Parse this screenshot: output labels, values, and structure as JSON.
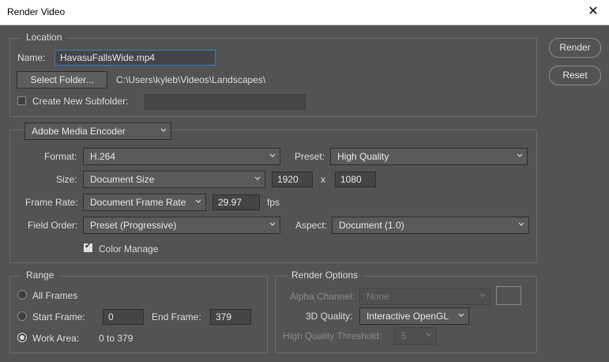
{
  "window": {
    "title": "Render Video",
    "close_glyph": "✕"
  },
  "buttons": {
    "render": "Render",
    "reset": "Reset"
  },
  "location": {
    "legend": "Location",
    "name_label": "Name:",
    "name_value": "HavasuFallsWide.mp4",
    "select_folder": "Select Folder...",
    "folder_path": "C:\\Users\\kyleb\\Videos\\Landscapes\\",
    "subfolder_label": "Create New Subfolder:",
    "subfolder_checked": false,
    "subfolder_value": ""
  },
  "encoder": {
    "selected": "Adobe Media Encoder",
    "format_label": "Format:",
    "format_value": "H.264",
    "preset_label": "Preset:",
    "preset_value": "High Quality",
    "size_label": "Size:",
    "size_value": "Document Size",
    "width": "1920",
    "x_sep": "x",
    "height": "1080",
    "frame_rate_label": "Frame Rate:",
    "frame_rate_value": "Document Frame Rate",
    "fps_value": "29.97",
    "fps_unit": "fps",
    "field_order_label": "Field Order:",
    "field_order_value": "Preset (Progressive)",
    "aspect_label": "Aspect:",
    "aspect_value": "Document (1.0)",
    "color_manage_label": "Color Manage",
    "color_manage_checked": true
  },
  "range": {
    "legend": "Range",
    "all_frames": "All Frames",
    "start_frame_label": "Start Frame:",
    "start_frame_value": "0",
    "end_frame_label": "End Frame:",
    "end_frame_value": "379",
    "work_area_label": "Work Area:",
    "work_area_value": "0 to 379",
    "selected": "Work Area:"
  },
  "render_options": {
    "legend": "Render Options",
    "alpha_channel_label": "Alpha Channel:",
    "alpha_channel_value": "None",
    "quality_3d_label": "3D Quality:",
    "quality_3d_value": "Interactive OpenGL",
    "hq_threshold_label": "High Quality Threshold:",
    "hq_threshold_value": "5"
  },
  "icons": {
    "dropdown": "chevron-down-icon",
    "close": "close-icon"
  }
}
